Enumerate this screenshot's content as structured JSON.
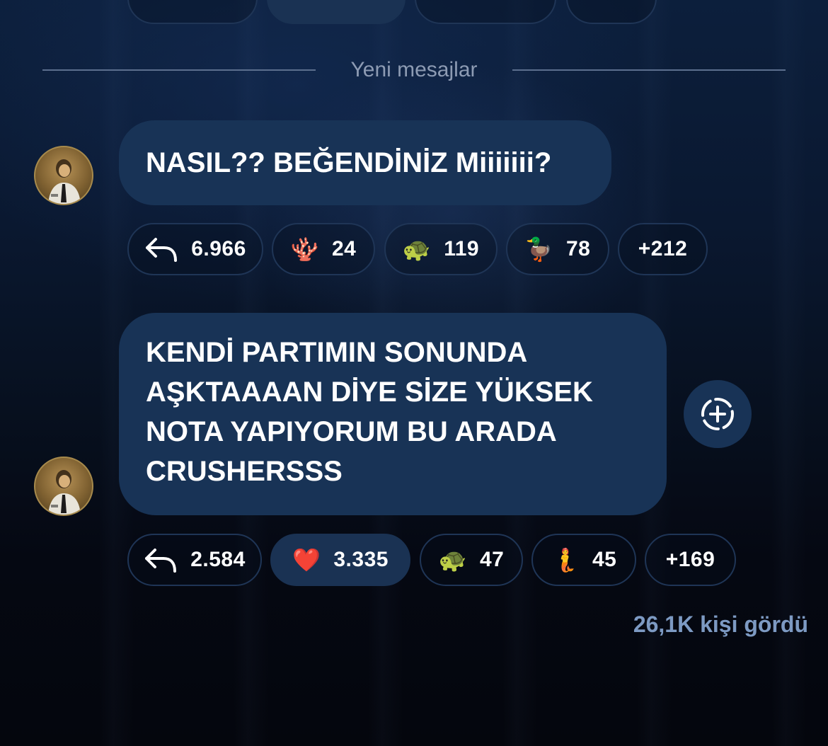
{
  "divider": {
    "label": "Yeni mesajlar"
  },
  "messages": [
    {
      "text": "NASIL?? BEĞENDİNİZ Miiiiiii?",
      "reactions": [
        {
          "icon": "reply-icon",
          "count": "6.966",
          "selected": false
        },
        {
          "icon": "coral-emoji",
          "emoji": "🪸",
          "count": "24",
          "selected": false
        },
        {
          "icon": "turtle-emoji",
          "emoji": "🐢",
          "count": "119",
          "selected": false
        },
        {
          "icon": "duck-emoji",
          "emoji": "🦆",
          "count": "78",
          "selected": false
        },
        {
          "icon": "more",
          "count": "+212",
          "selected": false
        }
      ]
    },
    {
      "text": "KENDİ PARTIMIN SONUNDA AŞKTAAAAN DİYE SİZE YÜKSEK NOTA YAPIYORUM BU ARADA CRUSHERSSS",
      "lines": [
        "KENDİ PARTIMIN SONUNDA",
        "AŞKTAAAAN DİYE SİZE YÜKSEK",
        "NOTA YAPIYORUM BU ARADA",
        "CRUSHERSSS"
      ],
      "reactions": [
        {
          "icon": "reply-icon",
          "count": "2.584",
          "selected": false
        },
        {
          "icon": "heart-emoji",
          "emoji": "❤️",
          "count": "3.335",
          "selected": true
        },
        {
          "icon": "turtle-emoji",
          "emoji": "🐢",
          "count": "47",
          "selected": false
        },
        {
          "icon": "merperson-emoji",
          "emoji": "🧜",
          "count": "45",
          "selected": false
        },
        {
          "icon": "more",
          "count": "+169",
          "selected": false
        }
      ]
    }
  ],
  "views": "26,1K kişi gördü",
  "colors": {
    "bubble": "#183356",
    "pill_border": "#1f3556",
    "pill_selected": "#1a3253",
    "views_text": "#7d9ac3",
    "divider_text": "#8d9bb3"
  }
}
